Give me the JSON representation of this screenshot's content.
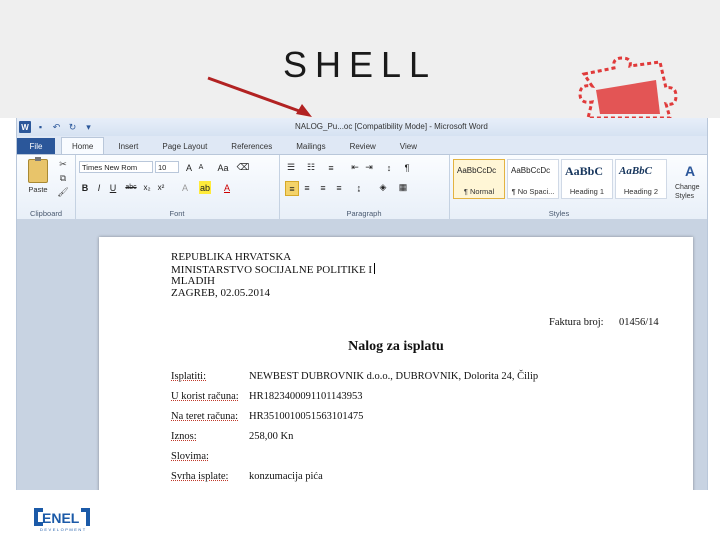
{
  "slide": {
    "title": "SHELL"
  },
  "word": {
    "window_title": "NALOG_Pu...oc [Compatibility Mode] - Microsoft Word",
    "tabs": [
      "File",
      "Home",
      "Insert",
      "Page Layout",
      "References",
      "Mailings",
      "Review",
      "View"
    ],
    "active_tab": "Home",
    "ribbon": {
      "clipboard": {
        "label": "Clipboard",
        "paste": "Paste"
      },
      "font": {
        "label": "Font",
        "family": "Times New Rom",
        "size": "10",
        "grow": "A",
        "shrink": "A",
        "case": "Aa"
      },
      "paragraph": {
        "label": "Paragraph",
        "pilcrow": "¶"
      },
      "styles": {
        "label": "Styles",
        "items": [
          {
            "sample": "AaBbCcDc",
            "name": "¶ Normal"
          },
          {
            "sample": "AaBbCcDc",
            "name": "¶ No Spaci..."
          },
          {
            "sample": "AaBbC",
            "name": "Heading 1"
          },
          {
            "sample": "AaBbC",
            "name": "Heading 2"
          }
        ],
        "change_styles": "Change Styles"
      }
    }
  },
  "document": {
    "header": [
      "REPUBLIKA HRVATSKA",
      "MINISTARSTVO SOCIJALNE POLITIKE I",
      "MLADIH",
      "ZAGREB, 02.05.2014"
    ],
    "racun_label": "Faktura broj:",
    "racun_value": "01456/14",
    "heading": "Nalog za isplatu",
    "rows": [
      {
        "label": "Isplatiti:",
        "value": "NEWBEST DUBROVNIK d.o.o., DUBROVNIK, Dolorita 24, Čilip"
      },
      {
        "label": "U korist računa:",
        "value": "HR1823400091101143953"
      },
      {
        "label": "Na teret računa:",
        "value": "HR3510010051563101475"
      },
      {
        "label": "Iznos:",
        "value": "258,00 Kn"
      },
      {
        "label": "Slovima:",
        "value": ""
      },
      {
        "label": "Svrha isplate:",
        "value": "konzumacija pića"
      }
    ]
  },
  "logo": {
    "name": "ENEL",
    "tagline": "DEVELOPMENT"
  },
  "colors": {
    "accent": "#2b579a",
    "arrow": "#b22222",
    "puzzle": "#e03a3a",
    "logo": "#1b5aa8"
  }
}
